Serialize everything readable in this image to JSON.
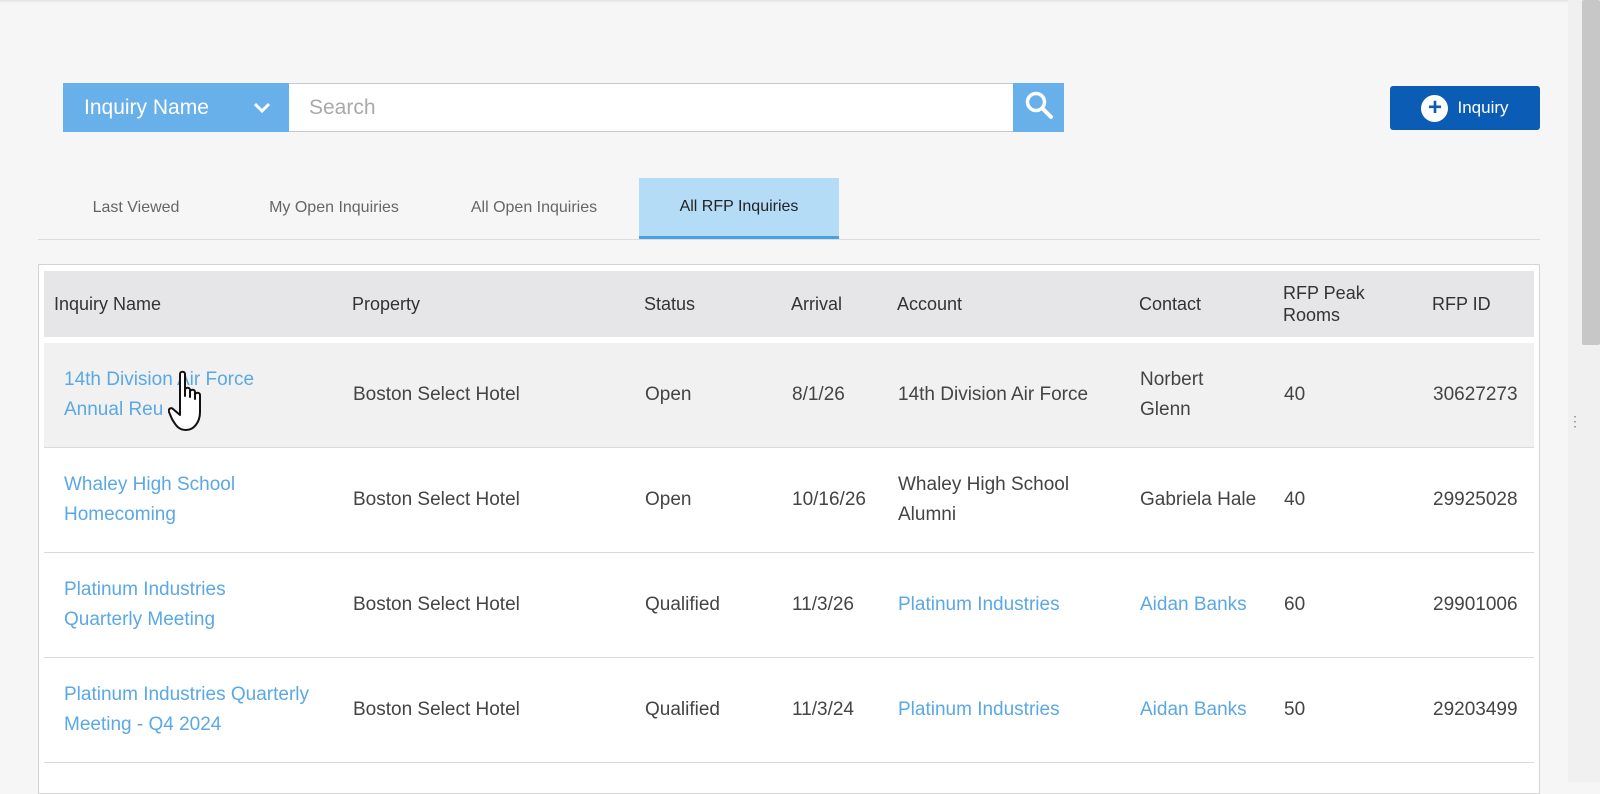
{
  "search": {
    "type_label": "Inquiry Name",
    "placeholder": "Search",
    "value": ""
  },
  "add_button": {
    "label": "Inquiry",
    "icon": "plus-circle-icon"
  },
  "tabs": [
    {
      "label": "Last Viewed",
      "active": false
    },
    {
      "label": "My Open Inquiries",
      "active": false
    },
    {
      "label": "All Open Inquiries",
      "active": false
    },
    {
      "label": "All RFP Inquiries",
      "active": true
    }
  ],
  "table": {
    "columns": [
      "Inquiry Name",
      "Property",
      "Status",
      "Arrival",
      "Account",
      "Contact",
      "RFP Peak Rooms",
      "RFP ID"
    ],
    "rows": [
      {
        "inquiry_name": "14th Division Air Force Annual Reu",
        "property": "Boston Select Hotel",
        "status": "Open",
        "arrival": "8/1/26",
        "account": "14th Division Air Force",
        "contact": "Norbert Glenn",
        "rfp_peak_rooms": "40",
        "rfp_id": "30627273"
      },
      {
        "inquiry_name": "Whaley High School Homecoming",
        "property": "Boston Select Hotel",
        "status": "Open",
        "arrival": "10/16/26",
        "account": "Whaley High School Alumni",
        "contact": "Gabriela Hale",
        "rfp_peak_rooms": "40",
        "rfp_id": "29925028"
      },
      {
        "inquiry_name": "Platinum Industries Quarterly Meeting",
        "property": "Boston Select Hotel",
        "status": "Qualified",
        "arrival": "11/3/26",
        "account": "Platinum Industries",
        "contact": "Aidan Banks",
        "rfp_peak_rooms": "60",
        "rfp_id": "29901006"
      },
      {
        "inquiry_name": "Platinum Industries Quarterly Meeting - Q4 2024",
        "property": "Boston Select Hotel",
        "status": "Qualified",
        "arrival": "11/3/24",
        "account": "Platinum Industries",
        "contact": "Aidan Banks",
        "rfp_peak_rooms": "50",
        "rfp_id": "29203499"
      }
    ]
  },
  "colors": {
    "accent": "#68b0ea",
    "primary_button": "#0b5cb5",
    "active_tab": "#b4dcf6",
    "link": "#5aa8e4"
  }
}
